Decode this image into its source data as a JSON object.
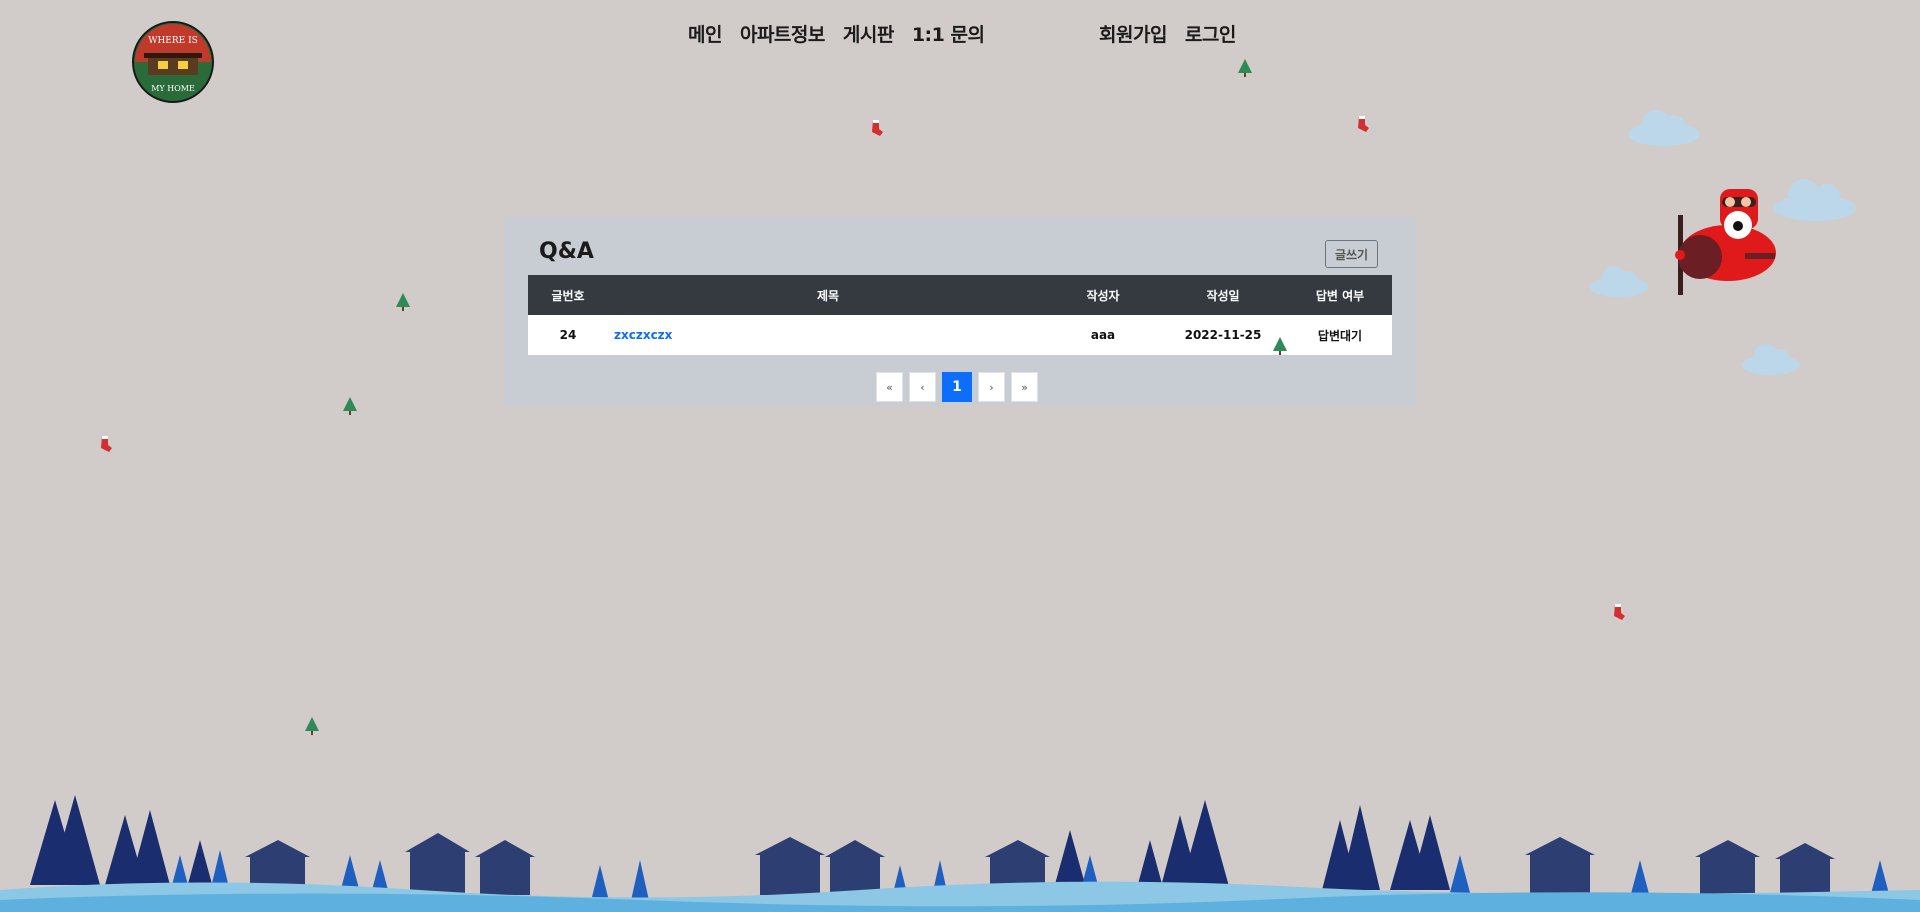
{
  "logo": {
    "text_top": "WHERE IS",
    "text_bottom": "MY HOME"
  },
  "nav": {
    "main": [
      "메인",
      "아파트정보",
      "게시판",
      "1:1 문의"
    ],
    "auth": [
      "회원가입",
      "로그인"
    ]
  },
  "board": {
    "title": "Q&A",
    "write_label": "글쓰기",
    "columns": [
      "글번호",
      "제목",
      "작성자",
      "작성일",
      "답변 여부"
    ],
    "rows": [
      {
        "no": "24",
        "title": "zxczxczx",
        "author": "aaa",
        "date": "2022-11-25",
        "status": "답변대기"
      }
    ]
  },
  "pagination": {
    "first": "«",
    "prev": "‹",
    "current": "1",
    "next": "›",
    "last": "»"
  },
  "colors": {
    "background": "#d1ccc9",
    "panel": "#c8cdd3",
    "table_header": "#343a40",
    "link": "#0d6efd",
    "active_page": "#0d6efd"
  }
}
